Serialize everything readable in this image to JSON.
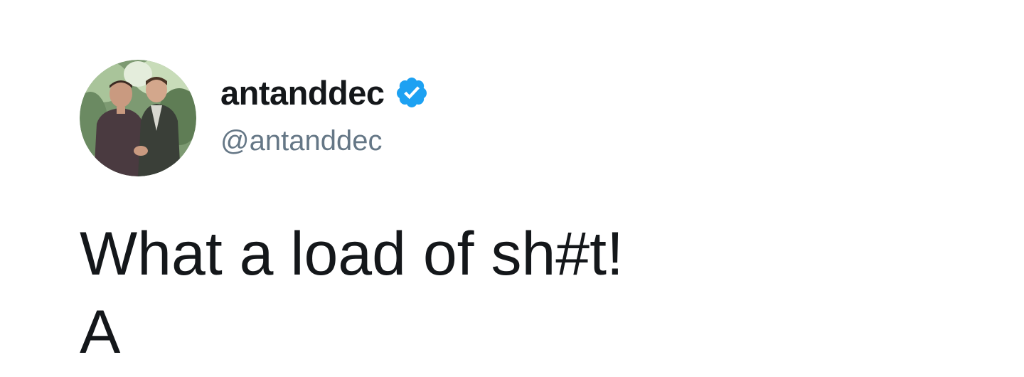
{
  "user": {
    "display_name": "antanddec",
    "handle": "@antanddec",
    "verified": true,
    "avatar_icon": "profile-photo",
    "verified_color": "#1da1f2"
  },
  "tweet": {
    "lines": [
      "What a load of sh#t!",
      "A"
    ]
  }
}
